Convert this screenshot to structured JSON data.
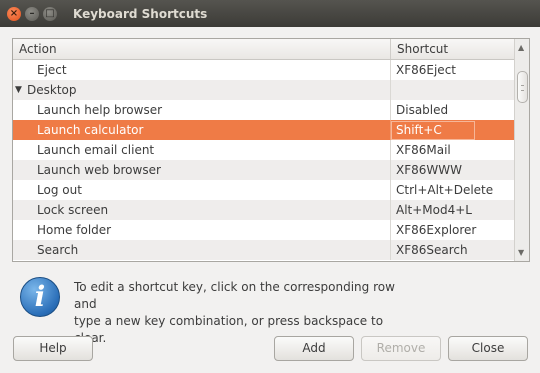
{
  "window": {
    "title": "Keyboard Shortcuts",
    "controls": {
      "close": "×",
      "minimize": "–",
      "maximize": "□"
    }
  },
  "table": {
    "columns": {
      "action": "Action",
      "shortcut": "Shortcut"
    },
    "rows": [
      {
        "action": "Eject",
        "shortcut": "XF86Eject"
      },
      {
        "action": "Desktop",
        "shortcut": "",
        "group": true,
        "expander": "▼"
      },
      {
        "action": "Launch help browser",
        "shortcut": "Disabled"
      },
      {
        "action": "Launch calculator",
        "shortcut": "Shift+C",
        "selected": true
      },
      {
        "action": "Launch email client",
        "shortcut": "XF86Mail"
      },
      {
        "action": "Launch web browser",
        "shortcut": "XF86WWW"
      },
      {
        "action": "Log out",
        "shortcut": "Ctrl+Alt+Delete"
      },
      {
        "action": "Lock screen",
        "shortcut": "Alt+Mod4+L"
      },
      {
        "action": "Home folder",
        "shortcut": "XF86Explorer"
      },
      {
        "action": "Search",
        "shortcut": "XF86Search"
      }
    ],
    "scrollbar": {
      "up": "▲",
      "down": "▼"
    }
  },
  "info": {
    "icon": "info-icon",
    "glyph": "i",
    "line1": "To edit a shortcut key, click on the corresponding row and",
    "line2": "type a new key combination, or press backspace to clear."
  },
  "buttons": {
    "help": "Help",
    "add": "Add",
    "remove": "Remove",
    "close": "Close"
  },
  "colors": {
    "selection": "#ef7b46",
    "titlebar": "#3c3b37",
    "window_bg": "#f2f1f0"
  }
}
